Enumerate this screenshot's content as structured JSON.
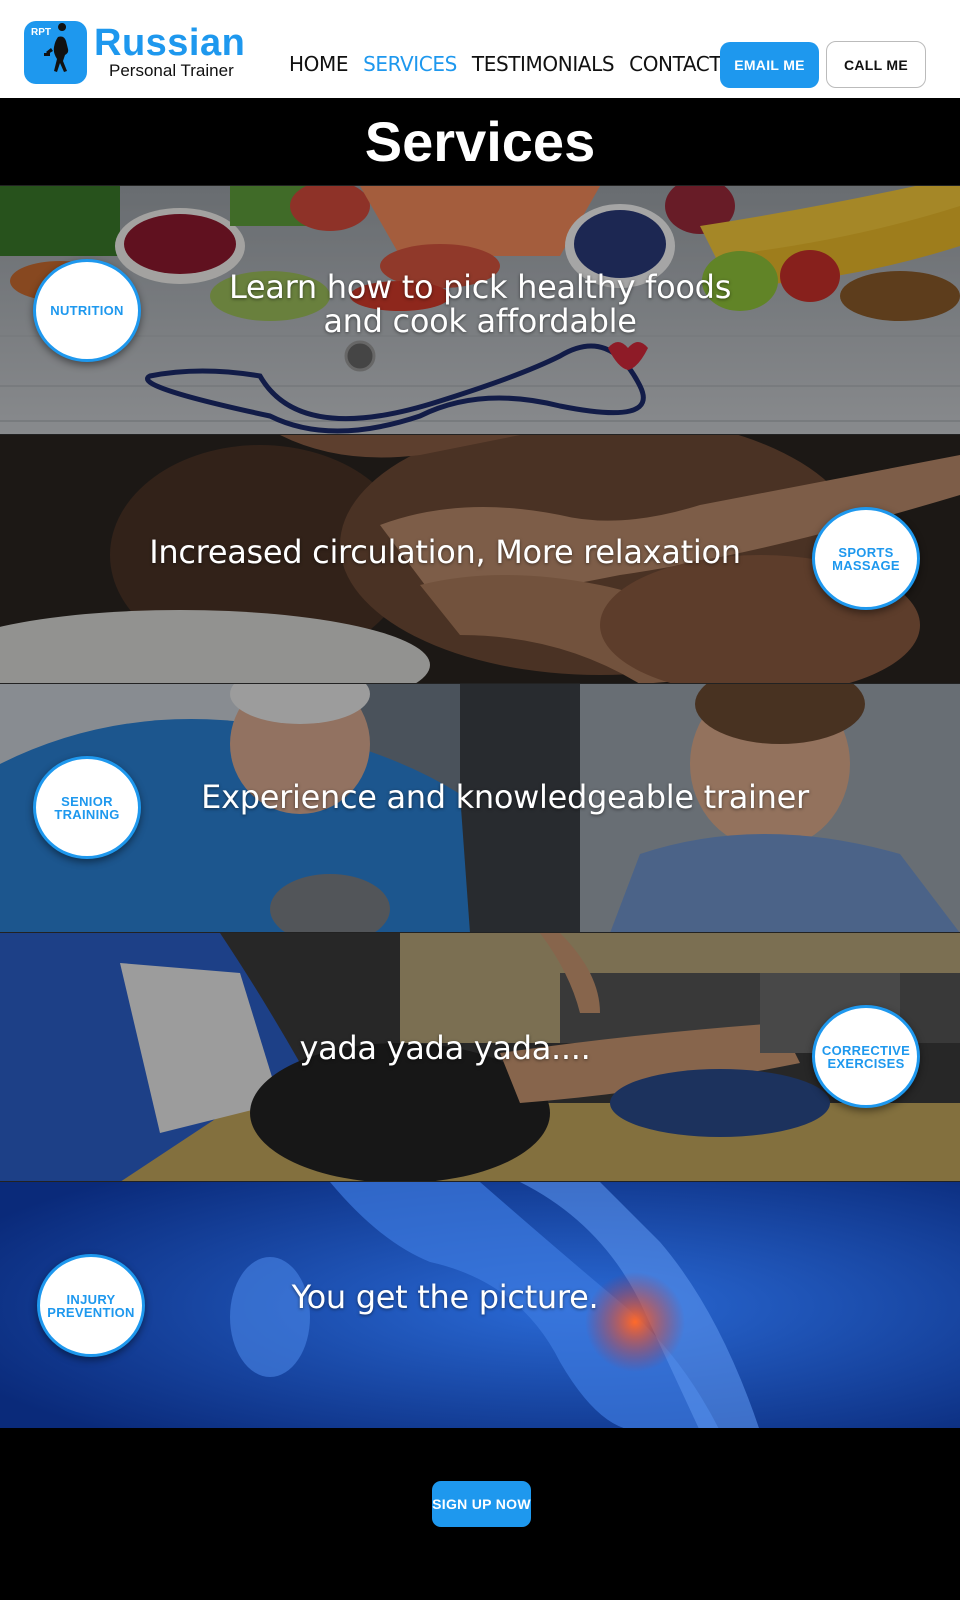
{
  "header": {
    "logo": {
      "abbr": "RPT",
      "name": "Russian",
      "subtitle": "Personal Trainer"
    },
    "nav": [
      {
        "label": "HOME",
        "active": false
      },
      {
        "label": "SERVICES",
        "active": true
      },
      {
        "label": "TESTIMONIALS",
        "active": false
      },
      {
        "label": "CONTACT",
        "active": false
      }
    ],
    "email_button": "EMAIL ME",
    "call_button": "CALL ME"
  },
  "page_title": "Services",
  "services": [
    {
      "badge": "NUTRITION",
      "caption_line1": "Learn how to pick healthy foods",
      "caption_line2": "and cook affordable"
    },
    {
      "badge": "SPORTS MASSAGE",
      "caption_line1": "Increased circulation, More relaxation"
    },
    {
      "badge": "SENIOR TRAINING",
      "caption_line1": "Experience and knowledgeable trainer"
    },
    {
      "badge": "CORRECTIVE EXERCISES",
      "caption_line1": "yada yada yada...."
    },
    {
      "badge": "INJURY PREVENTION",
      "caption_line1": "You get the picture."
    }
  ],
  "signup_button": "SIGN UP NOW",
  "colors": {
    "accent": "#1e98ee",
    "text": "#111111",
    "background": "#000000"
  }
}
